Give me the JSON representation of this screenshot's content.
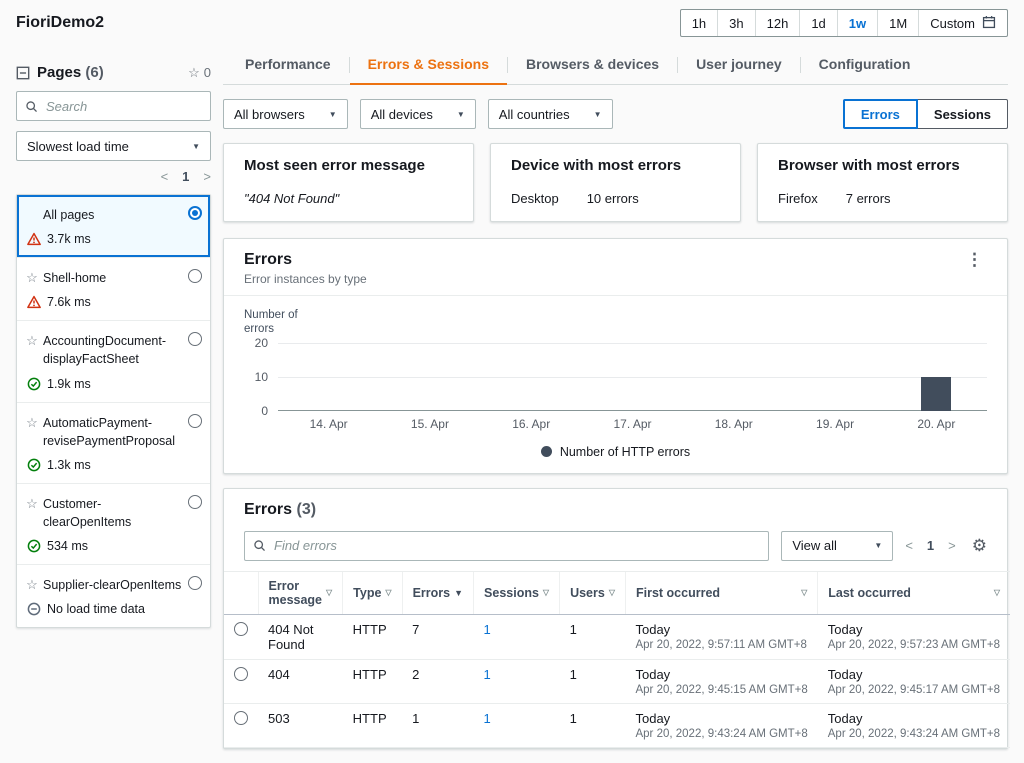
{
  "header": {
    "app_title": "FioriDemo2",
    "time_ranges": [
      "1h",
      "3h",
      "12h",
      "1d",
      "1w",
      "1M"
    ],
    "selected_range": "1w",
    "custom_label": "Custom"
  },
  "sidebar": {
    "title": "Pages",
    "count": "(6)",
    "star_count": "0",
    "search_placeholder": "Search",
    "sort_value": "Slowest load time",
    "page_number": "1",
    "items": [
      {
        "label": "All pages",
        "metric": "3.7k ms",
        "status": "warning",
        "selected": true,
        "star": false
      },
      {
        "label": "Shell-home",
        "metric": "7.6k ms",
        "status": "warning",
        "selected": false,
        "star": true
      },
      {
        "label": "AccountingDocument-displayFactSheet",
        "metric": "1.9k ms",
        "status": "success",
        "selected": false,
        "star": true
      },
      {
        "label": "AutomaticPayment-revisePaymentProposal",
        "metric": "1.3k ms",
        "status": "success",
        "selected": false,
        "star": true
      },
      {
        "label": "Customer-clearOpenItems",
        "metric": "534 ms",
        "status": "success",
        "selected": false,
        "star": true
      },
      {
        "label": "Supplier-clearOpenItems",
        "metric": "No load time data",
        "status": "nodata",
        "selected": false,
        "star": true
      }
    ]
  },
  "tabs": {
    "items": [
      "Performance",
      "Errors & Sessions",
      "Browsers & devices",
      "User journey",
      "Configuration"
    ],
    "active": "Errors & Sessions"
  },
  "filters": {
    "selects": [
      "All browsers",
      "All devices",
      "All countries"
    ],
    "toggle": [
      "Errors",
      "Sessions"
    ],
    "toggle_selected": "Errors"
  },
  "summary_cards": [
    {
      "title": "Most seen error message",
      "primary": "\"404 Not Found\"",
      "value": "",
      "quote": true
    },
    {
      "title": "Device with most errors",
      "primary": "Desktop",
      "value": "10 errors",
      "quote": false
    },
    {
      "title": "Browser with most errors",
      "primary": "Firefox",
      "value": "7 errors",
      "quote": false
    }
  ],
  "chart_panel": {
    "title": "Errors",
    "subtitle": "Error instances by type"
  },
  "chart_data": {
    "type": "bar",
    "title": "Errors",
    "ylabel": "Number of errors",
    "ylim": [
      0,
      20
    ],
    "yticks": [
      20,
      10,
      0
    ],
    "grid": true,
    "legend_position": "bottom",
    "categories": [
      "14. Apr",
      "15. Apr",
      "16. Apr",
      "17. Apr",
      "18. Apr",
      "19. Apr",
      "20. Apr"
    ],
    "series": [
      {
        "name": "Number of HTTP errors",
        "values": [
          0,
          0,
          0,
          0,
          0,
          0,
          10
        ],
        "color": "#414d5c"
      }
    ]
  },
  "errors_table": {
    "title": "Errors",
    "count": "(3)",
    "search_placeholder": "Find errors",
    "view_select": "View all",
    "page_number": "1",
    "columns": [
      {
        "label": "Error message",
        "sort": "none"
      },
      {
        "label": "Type",
        "sort": "none"
      },
      {
        "label": "Errors",
        "sort": "desc"
      },
      {
        "label": "Sessions",
        "sort": "none"
      },
      {
        "label": "Users",
        "sort": "none"
      },
      {
        "label": "First occurred",
        "sort": "none"
      },
      {
        "label": "Last occurred",
        "sort": "none"
      }
    ],
    "rows": [
      {
        "error_message": "404 Not Found",
        "type": "HTTP",
        "errors": "7",
        "sessions": "1",
        "users": "1",
        "first_day": "Today",
        "first_time": "Apr 20, 2022, 9:57:11 AM GMT+8",
        "last_day": "Today",
        "last_time": "Apr 20, 2022, 9:57:23 AM GMT+8"
      },
      {
        "error_message": "404",
        "type": "HTTP",
        "errors": "2",
        "sessions": "1",
        "users": "1",
        "first_day": "Today",
        "first_time": "Apr 20, 2022, 9:45:15 AM GMT+8",
        "last_day": "Today",
        "last_time": "Apr 20, 2022, 9:45:17 AM GMT+8"
      },
      {
        "error_message": "503",
        "type": "HTTP",
        "errors": "1",
        "sessions": "1",
        "users": "1",
        "first_day": "Today",
        "first_time": "Apr 20, 2022, 9:43:24 AM GMT+8",
        "last_day": "Today",
        "last_time": "Apr 20, 2022, 9:43:24 AM GMT+8"
      }
    ]
  },
  "icons": {
    "star-icon": "☆",
    "kebab-icon": "⋮",
    "gear-icon": "⚙",
    "chevron-down-icon": "▼",
    "sort-down-icon": "▽",
    "sort-active-icon": "▼",
    "prev-icon": "<",
    "next-icon": ">"
  },
  "colors": {
    "accent": "#0972d3",
    "active_tab": "#ec7211",
    "warning": "#d13212",
    "success": "#037f0c",
    "bar": "#414d5c",
    "selected_bg": "#f1faff"
  }
}
